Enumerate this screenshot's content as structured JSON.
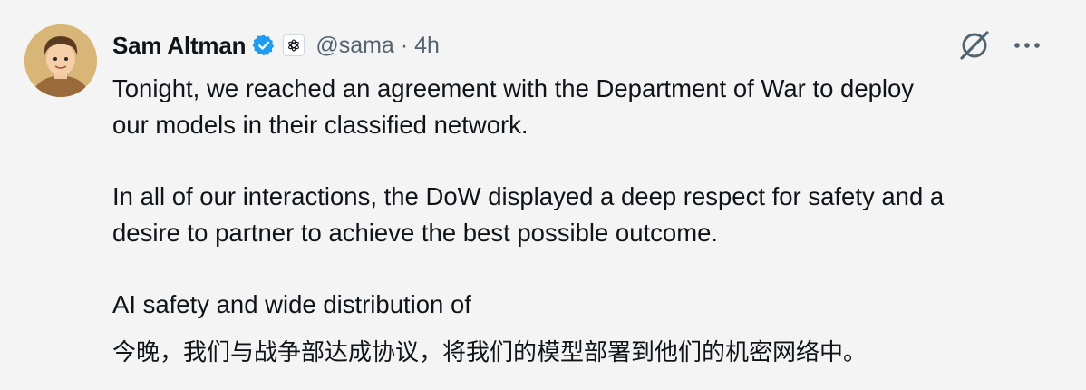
{
  "author": {
    "name": "Sam Altman",
    "handle": "@sama",
    "separator": "·",
    "time": "4h"
  },
  "icons": {
    "avatar": "profile-avatar",
    "verified": "verified-badge-icon",
    "affiliation": "openai-logo-icon",
    "grok": "grok-icon",
    "more": "more-options-icon"
  },
  "colors": {
    "verified": "#1d9bf0",
    "secondary_text": "#536471",
    "primary_text": "#0f1419",
    "background": "#f4f4f4"
  },
  "post": {
    "line1": "Tonight, we reached an agreement with the Department of War to deploy",
    "line2": "our models in their classified network.",
    "line3": "In all of our interactions, the DoW displayed a deep respect for safety and a",
    "line4": "desire to partner to achieve the best possible outcome.",
    "line5": "AI safety and wide distribution of",
    "translation": "今晚，我们与战争部达成协议，将我们的模型部署到他们的机密网络中。"
  }
}
